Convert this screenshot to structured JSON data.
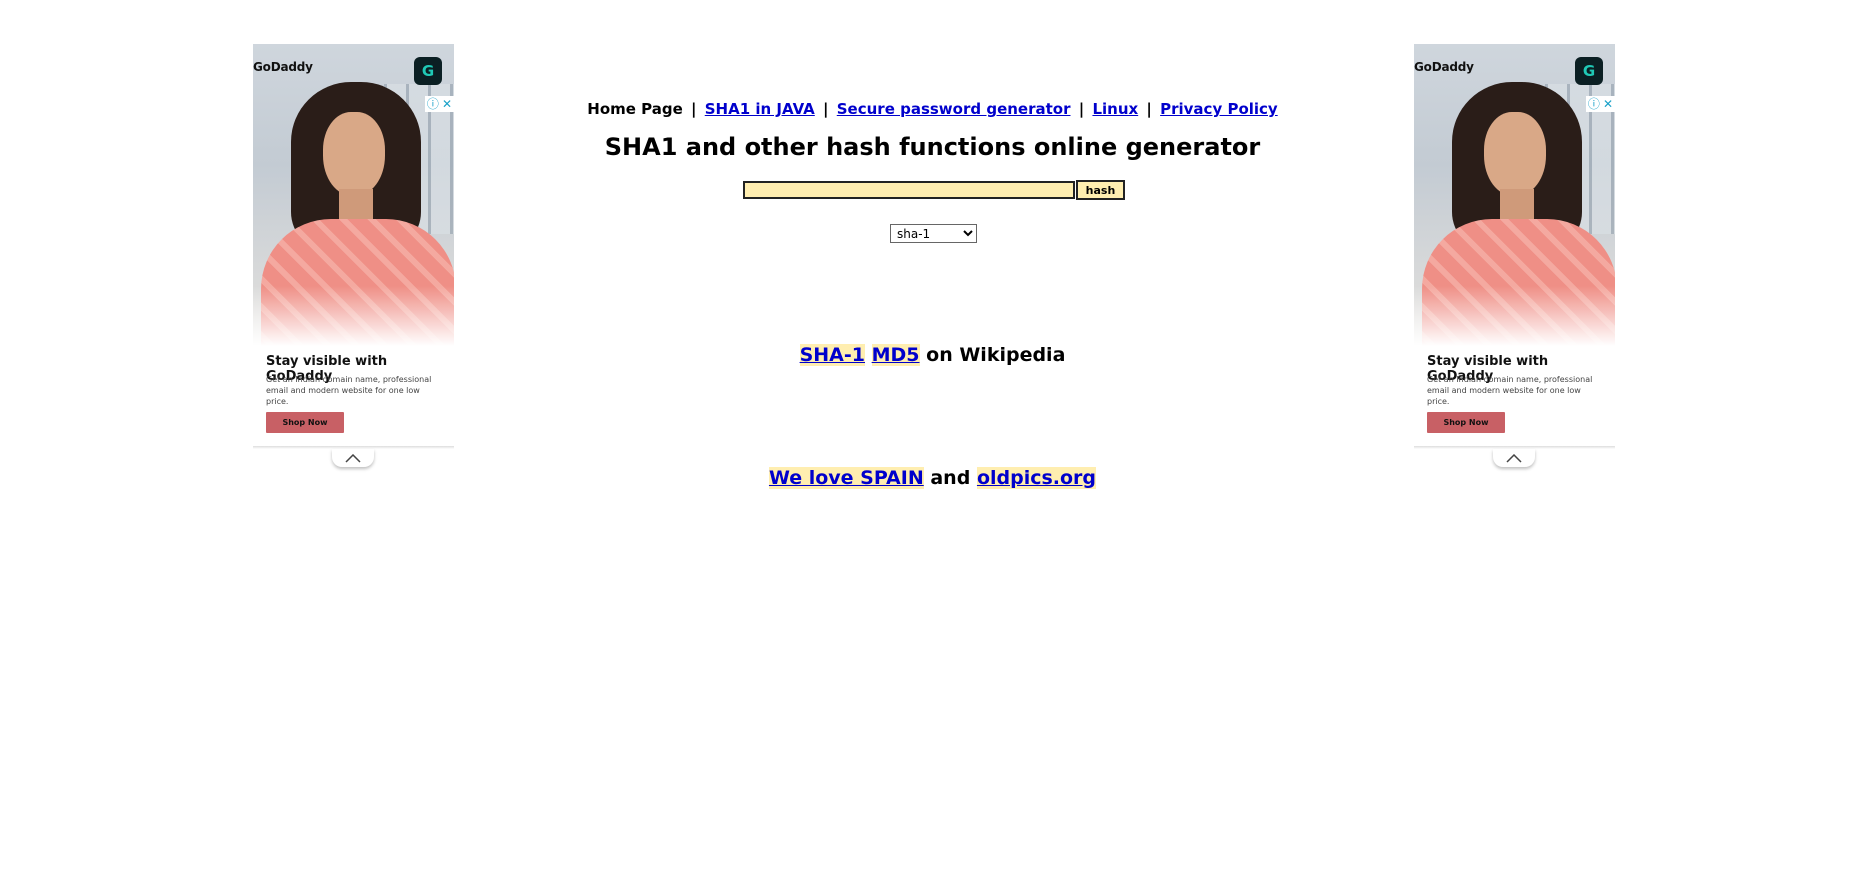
{
  "ads": [
    {
      "brand": "GoDaddy",
      "logo_icon": "godaddy-logo-icon",
      "title": "Stay visible with GoDaddy",
      "description": "Get an Indian domain name, professional email and modern website for one low price.",
      "cta": "Shop Now",
      "choices_info": "ⓘ",
      "choices_close": "✕"
    },
    {
      "brand": "GoDaddy",
      "logo_icon": "godaddy-logo-icon",
      "title": "Stay visible with GoDaddy",
      "description": "Get an Indian domain name, professional email and modern website for one low price.",
      "cta": "Shop Now",
      "choices_info": "ⓘ",
      "choices_close": "✕"
    }
  ],
  "nav": {
    "home": "Home Page",
    "separator": "|",
    "links": [
      "SHA1 in JAVA",
      "Secure password generator",
      "Linux",
      "Privacy Policy"
    ]
  },
  "title": "SHA1 and other hash functions online generator",
  "form": {
    "input_value": "",
    "button_label": "hash",
    "selected_algorithm": "sha-1"
  },
  "wiki": {
    "links": [
      "SHA-1",
      "MD5"
    ],
    "suffix": "on Wikipedia"
  },
  "footer": {
    "link1": "We love SPAIN",
    "conjunction": "and",
    "link2": "oldpics.org"
  },
  "colors": {
    "link": "#0000cc",
    "input_bg": "#ffeeb0",
    "cta_bg": "#c86065"
  }
}
